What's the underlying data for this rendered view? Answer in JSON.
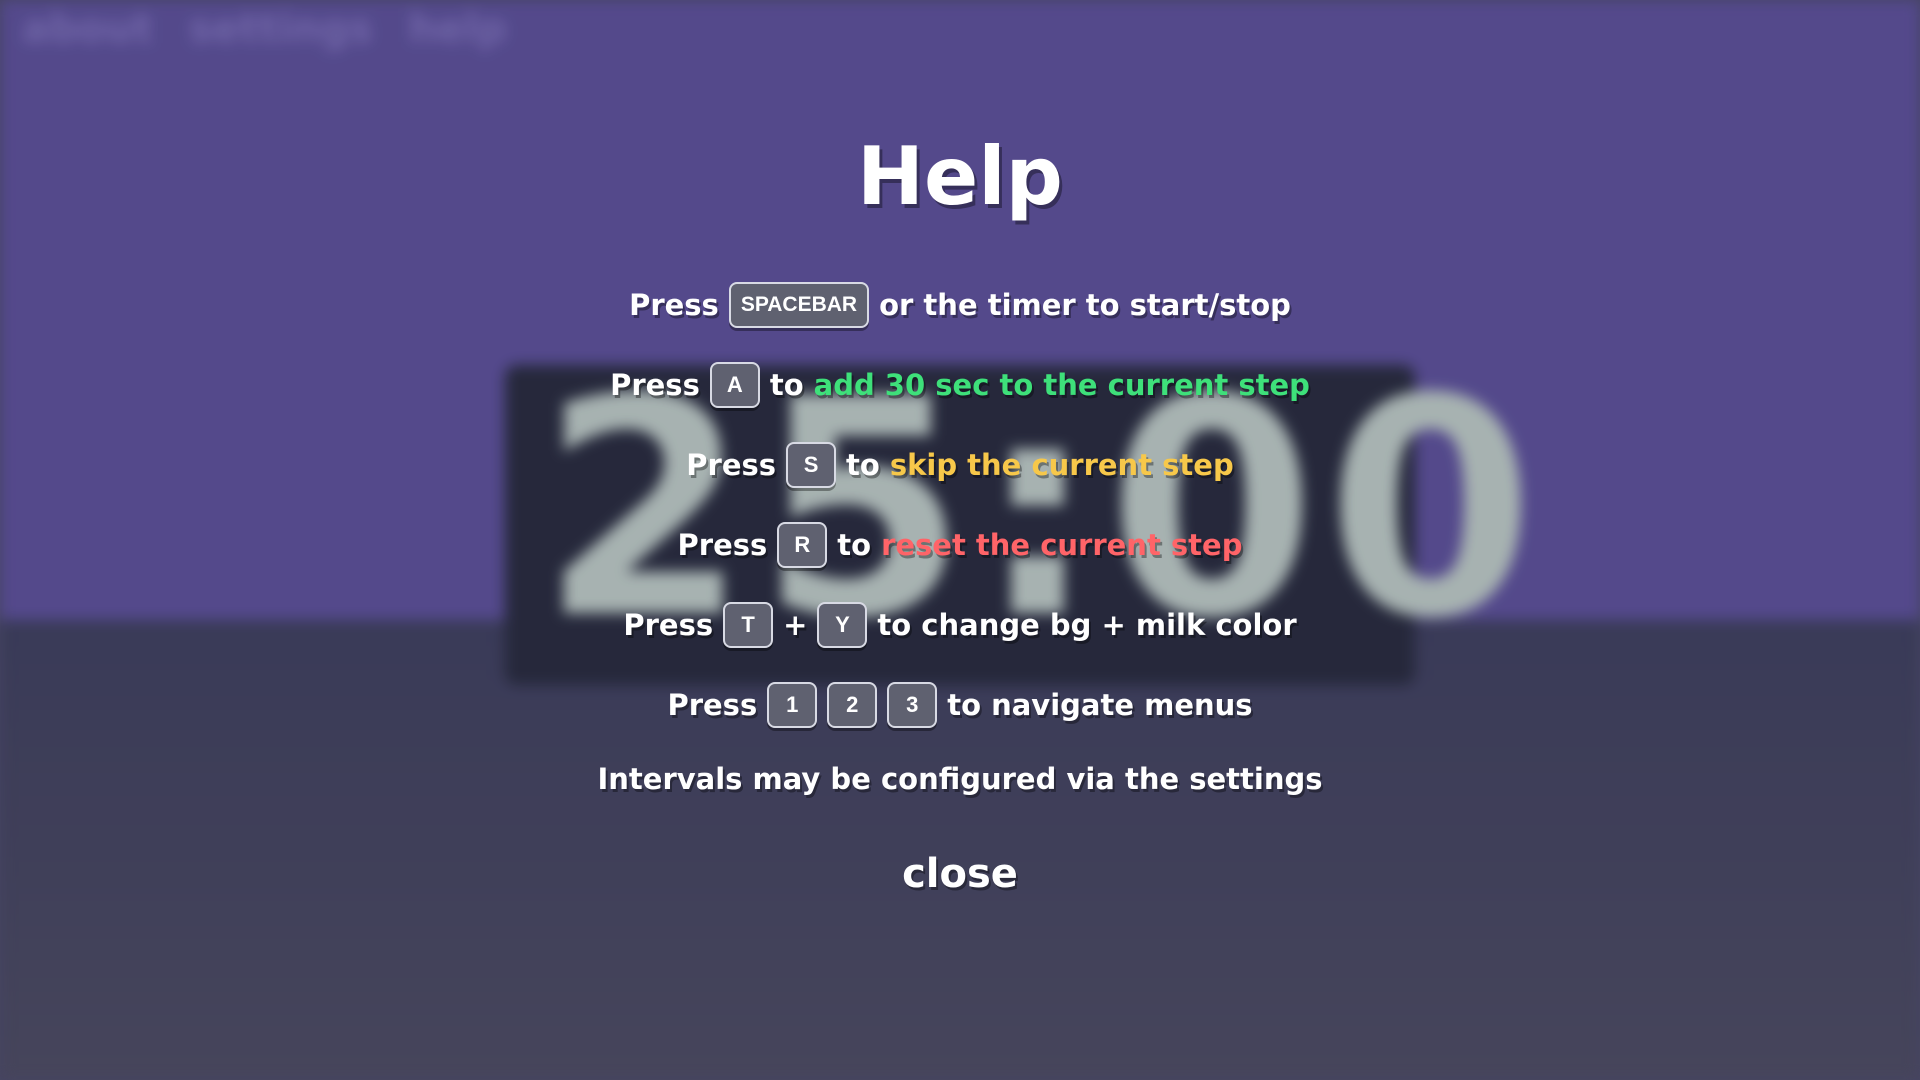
{
  "background": {
    "nav": [
      "about",
      "settings",
      "help"
    ],
    "timer": "25:00"
  },
  "help": {
    "title": "Help",
    "line1": {
      "press": "Press",
      "key": "SPACEBAR",
      "text": "or the timer to start/stop"
    },
    "line2": {
      "press": "Press",
      "key": "A",
      "to": "to",
      "action": "add 30 sec to the current step"
    },
    "line3": {
      "press": "Press",
      "key": "S",
      "to": "to",
      "action": "skip the current step"
    },
    "line4": {
      "press": "Press",
      "key": "R",
      "to": "to",
      "action": "reset the current step"
    },
    "line5": {
      "press": "Press",
      "key1": "T",
      "plus": "+",
      "key2": "Y",
      "text": "to change bg + milk color"
    },
    "line6": {
      "press": "Press",
      "keys": [
        "1",
        "2",
        "3"
      ],
      "text": "to navigate menus"
    },
    "note": "Intervals may be configured via the settings",
    "close_label": "close"
  },
  "colors": {
    "add": "#3ee07a",
    "skip": "#f7c84a",
    "reset": "#ff6468",
    "bg_top": "#5a4f95",
    "bg_bottom": "#3c3e5a"
  }
}
